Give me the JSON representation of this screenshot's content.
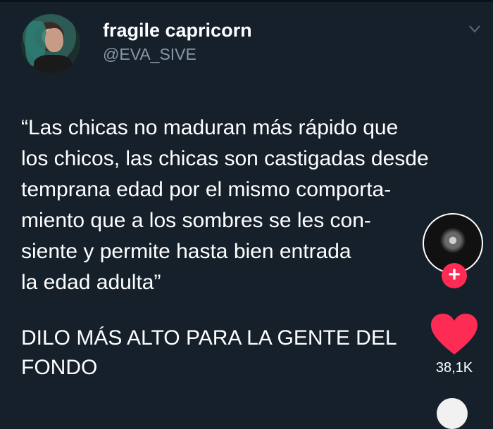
{
  "tweet": {
    "author": {
      "display_name": "fragile capricorn",
      "handle": "@EVA_SIVE"
    },
    "text_lines": [
      "“Las chicas no maduran más rápido que",
      "los chicos, las chicas son castigadas desde",
      "temprana edad por el mismo comporta-",
      "miento que a los sombres se les con-",
      "siente y permite hasta bien entrada",
      "la edad adulta”"
    ]
  },
  "caption_lines": [
    "DILO MÁS ALTO PARA LA GENTE DEL",
    "FONDO"
  ],
  "actions": {
    "follow_label": "+",
    "like_count": "38,1K"
  },
  "colors": {
    "background": "#15202b",
    "handle": "#8899a6",
    "like": "#fe2c55"
  },
  "icons": [
    "avatar",
    "chevron-down-icon",
    "creator-avatar",
    "plus-icon",
    "heart-icon"
  ]
}
